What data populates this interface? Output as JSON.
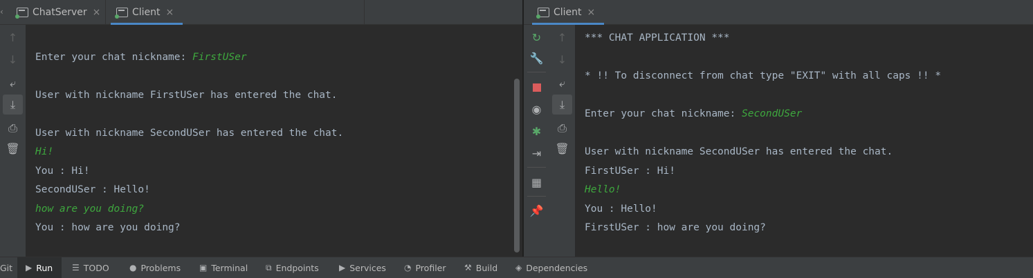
{
  "bottom_bar": {
    "items": [
      {
        "label": "Git",
        "icon": "git-icon"
      },
      {
        "label": "Run",
        "icon": "run-icon"
      },
      {
        "label": "TODO",
        "icon": "todo-icon"
      },
      {
        "label": "Problems",
        "icon": "problems-icon"
      },
      {
        "label": "Terminal",
        "icon": "terminal-icon"
      },
      {
        "label": "Endpoints",
        "icon": "endpoints-icon"
      },
      {
        "label": "Services",
        "icon": "services-icon"
      },
      {
        "label": "Profiler",
        "icon": "profiler-icon"
      },
      {
        "label": "Build",
        "icon": "build-icon"
      },
      {
        "label": "Dependencies",
        "icon": "dependencies-icon"
      }
    ]
  },
  "left": {
    "tabs": [
      {
        "label": "ChatServer",
        "close": "×"
      },
      {
        "label": "Client",
        "close": "×"
      }
    ],
    "lines": {
      "prompt_prefix": "Enter your chat nickname: ",
      "prompt_input": "FirstUSer",
      "entered_1": "User with nickname FirstUSer has entered the chat.",
      "entered_2": "User with nickname SecondUSer has entered the chat.",
      "input_1": "Hi!",
      "out_1": "You : Hi!",
      "out_2": "SecondUSer : Hello!",
      "input_2": "how are you doing?",
      "out_3": "You : how are you doing?"
    }
  },
  "right": {
    "tabs": [
      {
        "label": "Client",
        "close": "×"
      }
    ],
    "lines": {
      "header": "*** CHAT APPLICATION ***",
      "notice": "* !! To disconnect from chat type \"EXIT\" with all caps !! *",
      "prompt_prefix": "Enter your chat nickname: ",
      "prompt_input": "SecondUSer",
      "entered": "User with nickname SecondUSer has entered the chat.",
      "out_1": "FirstUSer : Hi!",
      "input_1": "Hello!",
      "out_2": "You : Hello!",
      "out_3": "FirstUSer : how are you doing?"
    }
  },
  "colors": {
    "background": "#2b2b2b",
    "panel": "#3c3f41",
    "console_text": "#a9b7c6",
    "user_input": "#3ea83e",
    "accent": "#4a88c7"
  }
}
